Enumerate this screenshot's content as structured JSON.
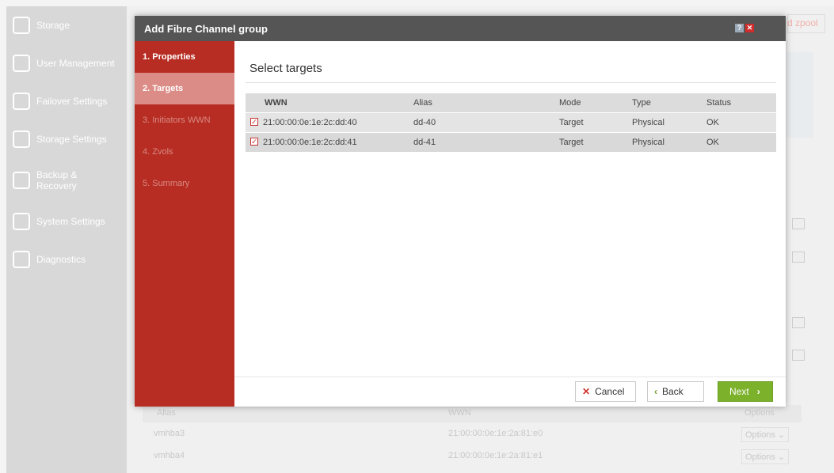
{
  "sidebar": {
    "items": [
      {
        "label": "Storage",
        "icon": "database-icon"
      },
      {
        "label": "User Management",
        "icon": "users-icon"
      },
      {
        "label": "Failover Settings",
        "icon": "failover-icon"
      },
      {
        "label": "Storage Settings",
        "icon": "storage-settings-icon"
      },
      {
        "label": "Backup & Recovery",
        "icon": "backup-icon"
      },
      {
        "label": "System Settings",
        "icon": "system-settings-icon"
      },
      {
        "label": "Diagnostics",
        "icon": "diagnostics-icon"
      }
    ]
  },
  "background": {
    "top_link": "d zpool",
    "table": {
      "headers": [
        "Alias",
        "WWN",
        "Options"
      ],
      "rows": [
        {
          "alias": "vmhba3",
          "wwn": "21:00:00:0e:1e:2a:81:e0",
          "options": "Options"
        },
        {
          "alias": "vmhba4",
          "wwn": "21:00:00:0e:1e:2a:81:e1",
          "options": "Options"
        }
      ]
    }
  },
  "modal": {
    "title": "Add Fibre Channel group",
    "help_glyph": "?",
    "close_glyph": "✕",
    "steps": [
      "1. Properties",
      "2. Targets",
      "3. Initiators WWN",
      "4. Zvols",
      "5. Summary"
    ],
    "active_step": 1,
    "heading": "Select targets",
    "table": {
      "headers": [
        "WWN",
        "Alias",
        "Mode",
        "Type",
        "Status"
      ],
      "rows": [
        {
          "wwn": "21:00:00:0e:1e:2c:dd:40",
          "alias": "dd-40",
          "mode": "Target",
          "type": "Physical",
          "status": "OK",
          "checked": true
        },
        {
          "wwn": "21:00:00:0e:1e:2c:dd:41",
          "alias": "dd-41",
          "mode": "Target",
          "type": "Physical",
          "status": "OK",
          "checked": true
        }
      ]
    },
    "buttons": {
      "cancel": "Cancel",
      "back": "Back",
      "next": "Next"
    }
  },
  "colors": {
    "accent_red": "#b72d23",
    "next_green": "#7cb12c",
    "title_bar": "#555555"
  }
}
